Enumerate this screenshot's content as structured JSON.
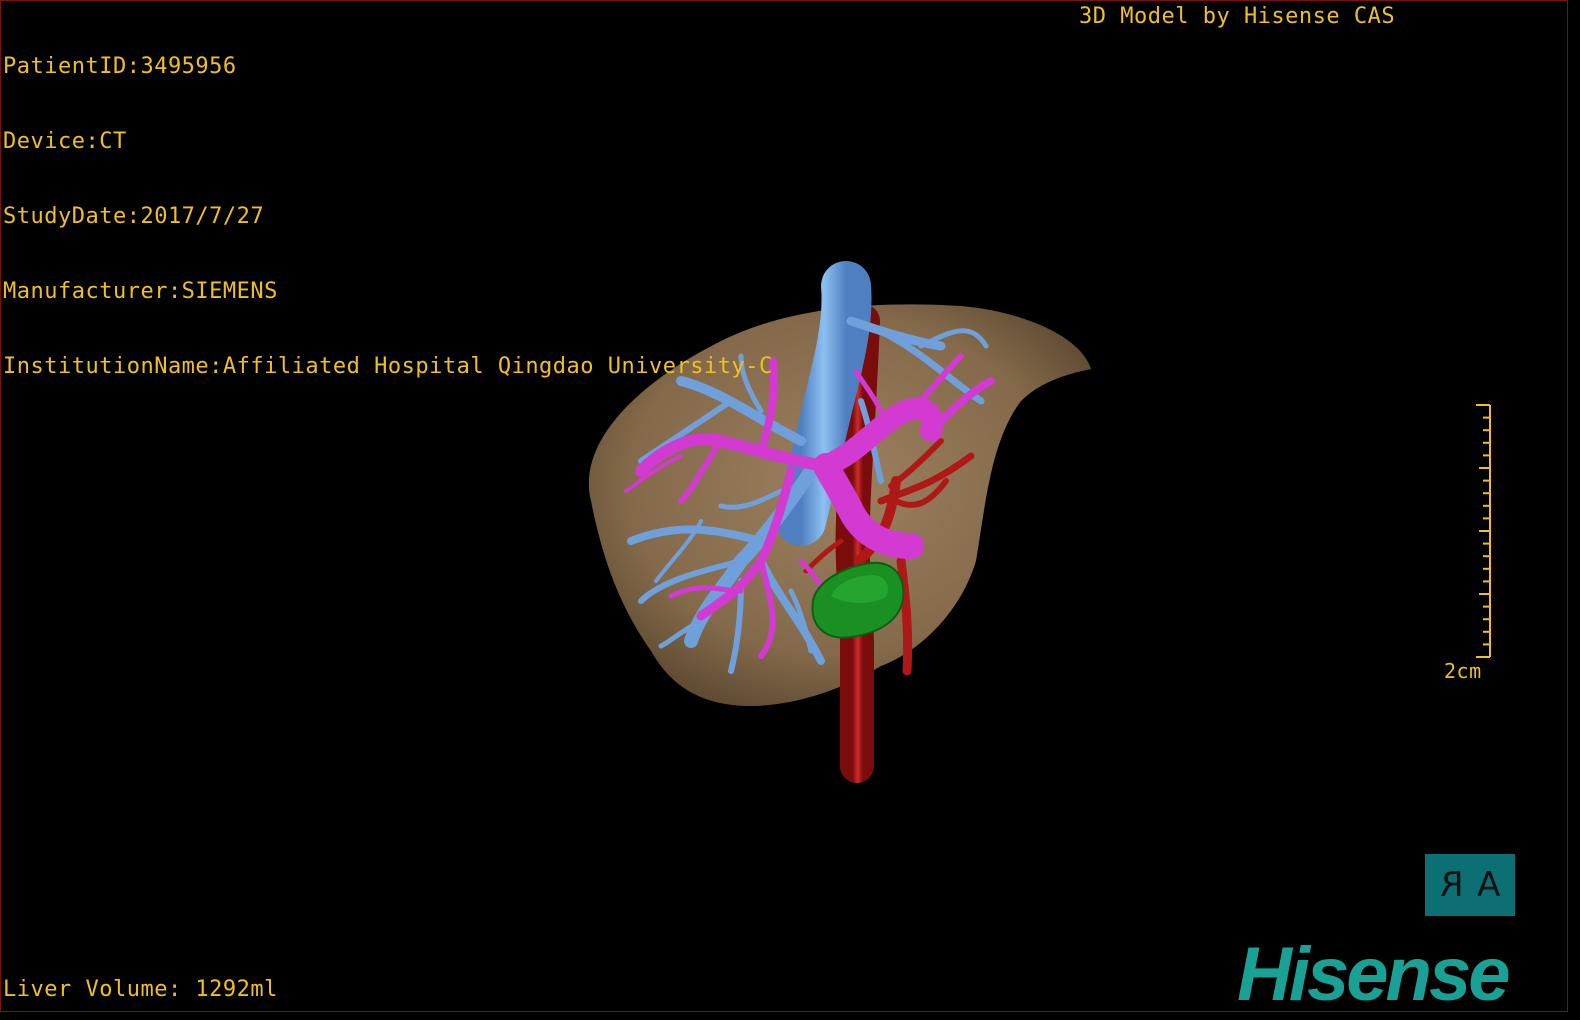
{
  "info": {
    "patient_id": "PatientID:3495956",
    "device": "Device:CT",
    "study_date": "StudyDate:2017/7/27",
    "manufacturer": "Manufacturer:SIEMENS",
    "institution": "InstitutionName:Affiliated Hospital Qingdao University-C"
  },
  "credit": "3D Model by Hisense CAS",
  "liver_volume": "Liver Volume: 1292ml",
  "scale_bar": {
    "label": "2cm"
  },
  "view_cube": {
    "left_face": "R",
    "right_face": "A"
  },
  "brand": "Hisense",
  "colors": {
    "overlay_text": "#f0c020",
    "liver": "#8a7150",
    "hepatic_vein": "#6fa0dc",
    "portal_vein": "#d23ad2",
    "artery": "#b01818",
    "lesion": "#1a8f22",
    "brand": "#1aa196",
    "view_cube": "#0c6f73"
  }
}
